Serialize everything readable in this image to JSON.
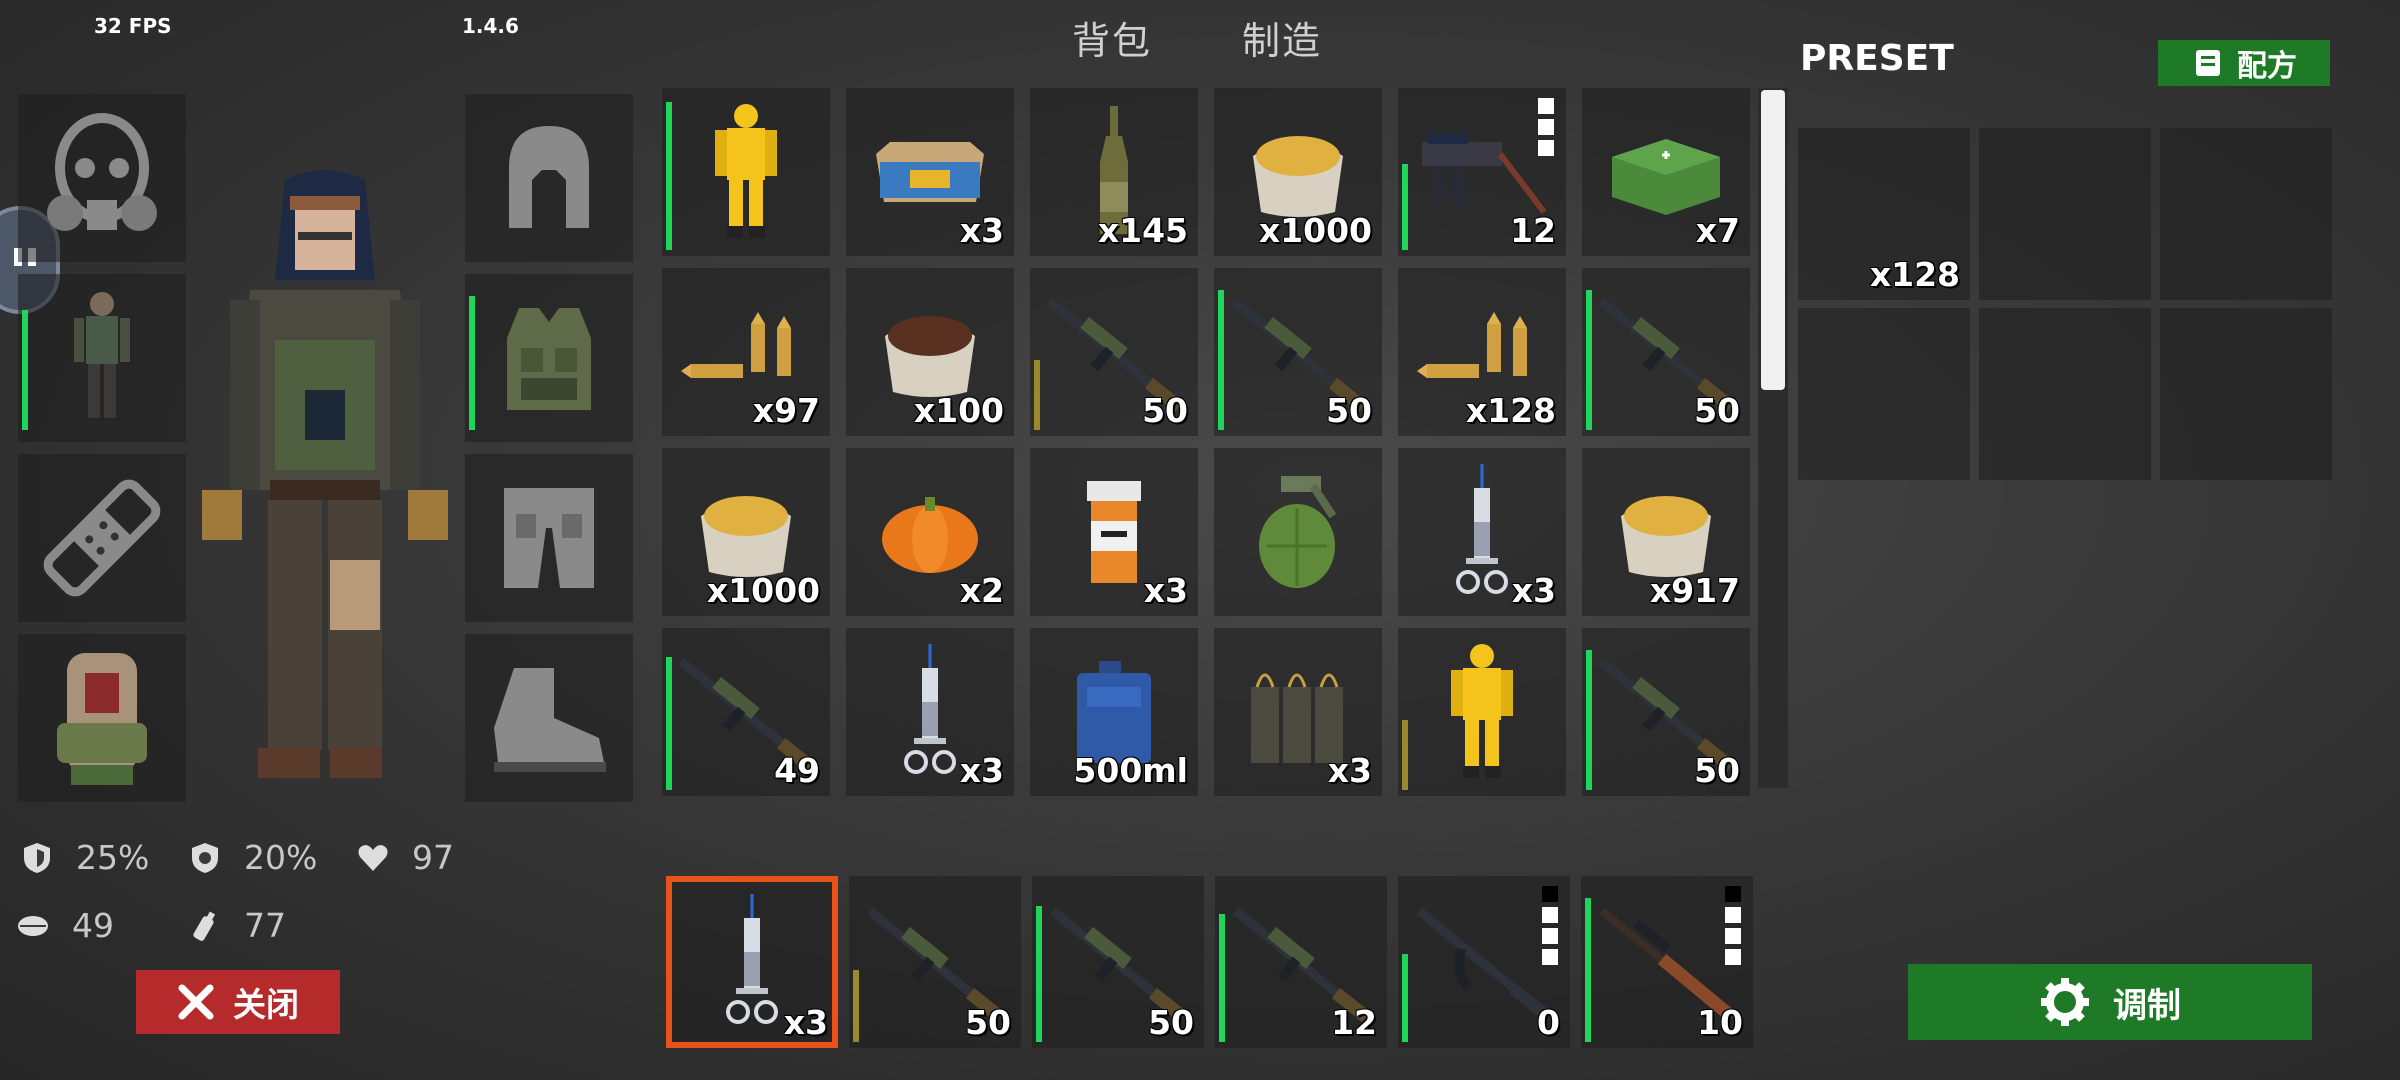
{
  "hud": {
    "fps": "32 FPS",
    "version": "1.4.6"
  },
  "tabs": {
    "backpack": "背包",
    "craft": "制造"
  },
  "preset": {
    "title": "PRESET",
    "recipe_label": "配方",
    "slots": [
      {
        "item": "ammo-rifle-icon",
        "qty": "x128"
      },
      {},
      {},
      {},
      {},
      {}
    ]
  },
  "stats": {
    "armor": "25%",
    "resistance": "20%",
    "health": "97",
    "food": "49",
    "water": "77"
  },
  "buttons": {
    "close": "关闭",
    "craft": "调制"
  },
  "inventory": [
    [
      {
        "item": "hazmat-suit-icon",
        "qty": "",
        "bar": "green",
        "fill": 0.95
      },
      {
        "item": "food-can-icon",
        "qty": "x3"
      },
      {
        "item": "bottle-icon",
        "qty": "x145"
      },
      {
        "item": "grain-sack-icon",
        "qty": "x1000"
      },
      {
        "item": "smg-icon",
        "qty": "12",
        "bar": "green",
        "fill": 0.55,
        "dots": 3
      },
      {
        "item": "ammo-crate-icon",
        "qty": "x7"
      }
    ],
    [
      {
        "item": "ammo-icon",
        "qty": "x97"
      },
      {
        "item": "coffee-sack-icon",
        "qty": "x100"
      },
      {
        "item": "rifle-icon",
        "qty": "50",
        "bar": "yellow",
        "fill": 0.45
      },
      {
        "item": "rifle-icon",
        "qty": "50",
        "bar": "green",
        "fill": 0.9
      },
      {
        "item": "ammo-icon",
        "qty": "x128"
      },
      {
        "item": "rifle-icon",
        "qty": "50",
        "bar": "green",
        "fill": 0.9
      }
    ],
    [
      {
        "item": "grain-sack-icon",
        "qty": "x1000"
      },
      {
        "item": "pumpkin-icon",
        "qty": "x2"
      },
      {
        "item": "pill-bottle-icon",
        "qty": "x3"
      },
      {
        "item": "grenade-icon",
        "qty": ""
      },
      {
        "item": "syringe-icon",
        "qty": "x3"
      },
      {
        "item": "grain-sack-icon",
        "qty": "x917"
      }
    ],
    [
      {
        "item": "rifle-icon",
        "qty": "49",
        "bar": "green",
        "fill": 0.85
      },
      {
        "item": "syringe-icon",
        "qty": "x3"
      },
      {
        "item": "jerrycan-icon",
        "qty": "500ml"
      },
      {
        "item": "magazine-pouch-icon",
        "qty": "x3"
      },
      {
        "item": "hazmat-suit-icon",
        "qty": "",
        "bar": "yellow",
        "fill": 0.45
      },
      {
        "item": "rifle-icon",
        "qty": "50",
        "bar": "green",
        "fill": 0.9
      }
    ]
  ],
  "hotbar": [
    {
      "item": "syringe-icon",
      "qty": "x3",
      "selected": true
    },
    {
      "item": "rifle-icon",
      "qty": "50",
      "bar": "yellow",
      "fill": 0.45
    },
    {
      "item": "rifle-icon",
      "qty": "50",
      "bar": "green",
      "fill": 0.85
    },
    {
      "item": "rifle-icon",
      "qty": "12",
      "bar": "green",
      "fill": 0.8
    },
    {
      "item": "ak-rifle-icon",
      "qty": "0",
      "bar": "green",
      "fill": 0.55,
      "dots": 4,
      "dots_black": 1
    },
    {
      "item": "hunting-rifle-icon",
      "qty": "10",
      "bar": "green",
      "fill": 0.9,
      "dots": 4,
      "dots_black": 1
    }
  ],
  "equipment_left": [
    "gas-mask-icon",
    "hazmat-suit-icon",
    "bandage-icon",
    "backpack-icon"
  ],
  "equipment_right": [
    "helmet-icon",
    "vest-icon",
    "pants-icon",
    "boots-icon"
  ],
  "colors": {
    "bar_green": "#1fd65a",
    "bar_yellow": "#9c8a2a",
    "close_red": "#b52a2a",
    "craft_green": "#1f7a28",
    "selected_orange": "#e8531c"
  }
}
